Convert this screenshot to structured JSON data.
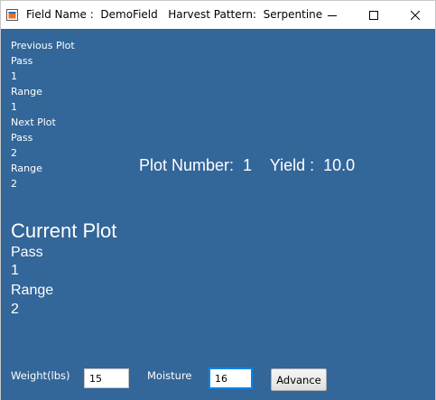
{
  "window": {
    "title": "Field Name :  DemoField   Harvest Pattern:  Serpentine"
  },
  "previous_plot": {
    "heading": "Previous Plot",
    "pass_label": "Pass",
    "pass_value": "1",
    "range_label": "Range",
    "range_value": "1"
  },
  "next_plot": {
    "heading": "Next Plot",
    "pass_label": "Pass",
    "pass_value": "2",
    "range_label": "Range",
    "range_value": "2"
  },
  "summary": {
    "text": "Plot Number:  1    Yield :  10.0"
  },
  "current_plot": {
    "heading": "Current Plot",
    "pass_label": "Pass",
    "pass_value": "1",
    "range_label": "Range",
    "range_value": "2"
  },
  "form": {
    "weight_label": "Weight(lbs)",
    "weight_value": "15",
    "moisture_label": "Moisture",
    "moisture_value": "16",
    "advance_label": "Advance"
  },
  "colors": {
    "background": "#336699",
    "text": "#ffffff",
    "focus_border": "#0a84e6"
  },
  "icons": {
    "app": "java-app-icon",
    "minimize": "minimize-icon",
    "maximize": "maximize-icon",
    "close": "close-icon"
  }
}
